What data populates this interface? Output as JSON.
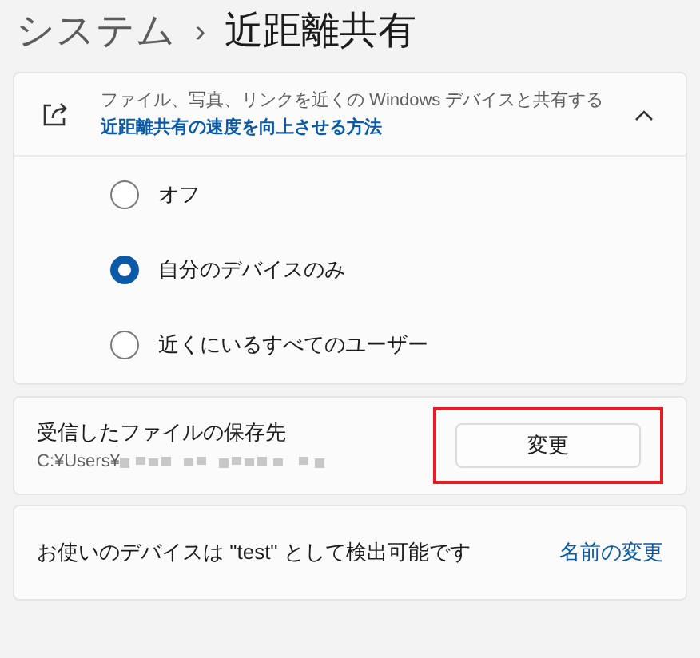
{
  "breadcrumb": {
    "parent": "システム",
    "separator": "›",
    "current": "近距離共有"
  },
  "sharing_card": {
    "description": "ファイル、写真、リンクを近くの Windows デバイスと共有する",
    "link": "近距離共有の速度を向上させる方法",
    "expanded": true,
    "options": [
      {
        "label": "オフ",
        "selected": false
      },
      {
        "label": "自分のデバイスのみ",
        "selected": true
      },
      {
        "label": "近くにいるすべてのユーザー",
        "selected": false
      }
    ]
  },
  "save_location": {
    "label": "受信したファイルの保存先",
    "path": "C:¥Users¥",
    "path_redacted": true,
    "button": "変更",
    "highlighted": true
  },
  "device_name": {
    "text": "お使いのデバイスは \"test\" として検出可能です",
    "link": "名前の変更"
  }
}
